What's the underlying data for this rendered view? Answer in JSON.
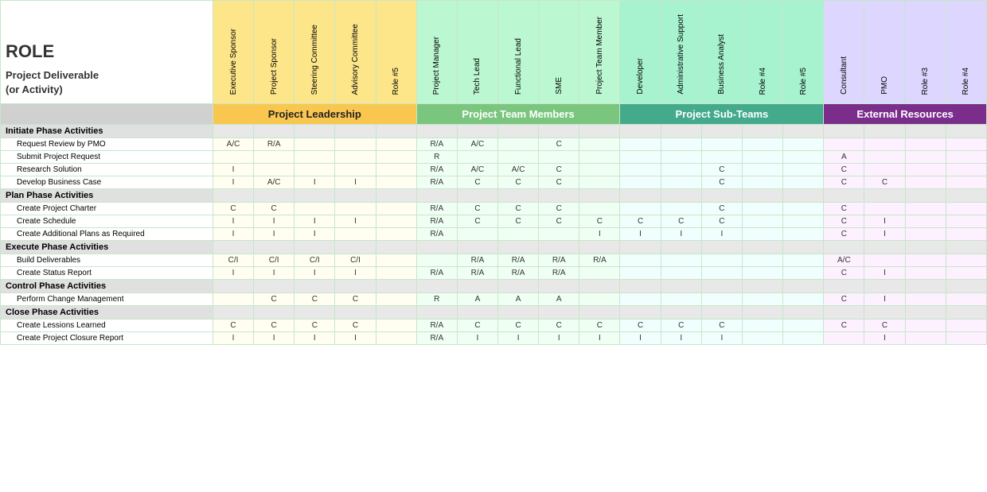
{
  "title": "ROLE",
  "leftHeader": {
    "line1": "Project Deliverable",
    "line2": "(or Activity)"
  },
  "groups": [
    {
      "id": "leadership",
      "label": "Project Leadership",
      "span": 5,
      "colorClass": "group-header-project-leadership",
      "headerClass": "header-cell-leadership"
    },
    {
      "id": "team",
      "label": "Project Team Members",
      "span": 5,
      "colorClass": "group-header-team-members",
      "headerClass": "header-cell-team"
    },
    {
      "id": "subteams",
      "label": "Project Sub-Teams",
      "span": 5,
      "colorClass": "group-header-sub-teams",
      "headerClass": "header-cell-subteam"
    },
    {
      "id": "external",
      "label": "External Resources",
      "span": 4,
      "colorClass": "group-header-external",
      "headerClass": "header-cell-external"
    }
  ],
  "roles": [
    {
      "label": "Executive Sponsor",
      "group": "leadership",
      "headerClass": "header-cell-leadership"
    },
    {
      "label": "Project Sponsor",
      "group": "leadership",
      "headerClass": "header-cell-leadership"
    },
    {
      "label": "Steering Committee",
      "group": "leadership",
      "headerClass": "header-cell-leadership"
    },
    {
      "label": "Advisory Committee",
      "group": "leadership",
      "headerClass": "header-cell-leadership"
    },
    {
      "label": "Role #5",
      "group": "leadership",
      "headerClass": "header-cell-leadership"
    },
    {
      "label": "Project Manager",
      "group": "team",
      "headerClass": "header-cell-team"
    },
    {
      "label": "Tech Lead",
      "group": "team",
      "headerClass": "header-cell-team"
    },
    {
      "label": "Functional Lead",
      "group": "team",
      "headerClass": "header-cell-team"
    },
    {
      "label": "SME",
      "group": "team",
      "headerClass": "header-cell-team"
    },
    {
      "label": "Project Team Member",
      "group": "team",
      "headerClass": "header-cell-team"
    },
    {
      "label": "Developer",
      "group": "subteams",
      "headerClass": "header-cell-subteam"
    },
    {
      "label": "Administrative Support",
      "group": "subteams",
      "headerClass": "header-cell-subteam"
    },
    {
      "label": "Business Analyst",
      "group": "subteams",
      "headerClass": "header-cell-subteam"
    },
    {
      "label": "Role #4",
      "group": "subteams",
      "headerClass": "header-cell-subteam"
    },
    {
      "label": "Role #5",
      "group": "subteams",
      "headerClass": "header-cell-subteam"
    },
    {
      "label": "Consultant",
      "group": "external",
      "headerClass": "header-cell-external"
    },
    {
      "label": "PMO",
      "group": "external",
      "headerClass": "header-cell-external"
    },
    {
      "label": "Role #3",
      "group": "external",
      "headerClass": "header-cell-external"
    },
    {
      "label": "Role #4",
      "group": "external",
      "headerClass": "header-cell-external"
    }
  ],
  "sections": [
    {
      "phase": "Initiate Phase Activities",
      "activities": [
        {
          "name": "Request Review by PMO",
          "cells": [
            "A/C",
            "R/A",
            "",
            "",
            "",
            "R/A",
            "A/C",
            "",
            "C",
            "",
            "",
            "",
            "",
            "",
            "",
            "",
            "",
            "",
            ""
          ]
        },
        {
          "name": "Submit Project Request",
          "cells": [
            "",
            "",
            "",
            "",
            "",
            "R",
            "",
            "",
            "",
            "",
            "",
            "",
            "",
            "",
            "",
            "A",
            "",
            "",
            ""
          ]
        },
        {
          "name": "Research Solution",
          "cells": [
            "I",
            "",
            "",
            "",
            "",
            "R/A",
            "A/C",
            "A/C",
            "C",
            "",
            "",
            "",
            "C",
            "",
            "",
            "C",
            "",
            "",
            ""
          ]
        },
        {
          "name": "Develop Business Case",
          "cells": [
            "I",
            "A/C",
            "I",
            "I",
            "",
            "R/A",
            "C",
            "C",
            "C",
            "",
            "",
            "",
            "C",
            "",
            "",
            "C",
            "C",
            "",
            ""
          ]
        }
      ]
    },
    {
      "phase": "Plan Phase Activities",
      "activities": [
        {
          "name": "Create Project Charter",
          "cells": [
            "C",
            "C",
            "",
            "",
            "",
            "R/A",
            "C",
            "C",
            "C",
            "",
            "",
            "",
            "C",
            "",
            "",
            "C",
            "",
            "",
            ""
          ]
        },
        {
          "name": "Create Schedule",
          "cells": [
            "I",
            "I",
            "I",
            "I",
            "",
            "R/A",
            "C",
            "C",
            "C",
            "C",
            "C",
            "C",
            "C",
            "",
            "",
            "C",
            "I",
            "",
            ""
          ]
        },
        {
          "name": "Create Additional Plans as Required",
          "cells": [
            "I",
            "I",
            "I",
            "",
            "",
            "R/A",
            "",
            "",
            "",
            "I",
            "I",
            "I",
            "I",
            "",
            "",
            "C",
            "I",
            "",
            ""
          ]
        }
      ]
    },
    {
      "phase": "Execute Phase Activities",
      "activities": [
        {
          "name": "Build Deliverables",
          "cells": [
            "C/I",
            "C/I",
            "C/I",
            "C/I",
            "",
            "",
            "R/A",
            "R/A",
            "R/A",
            "R/A",
            "",
            "",
            "",
            "",
            "",
            "A/C",
            "",
            "",
            ""
          ]
        },
        {
          "name": "Create Status Report",
          "cells": [
            "I",
            "I",
            "I",
            "I",
            "",
            "R/A",
            "R/A",
            "R/A",
            "R/A",
            "",
            "",
            "",
            "",
            "",
            "",
            "C",
            "I",
            "",
            ""
          ]
        }
      ]
    },
    {
      "phase": "Control Phase Activities",
      "activities": [
        {
          "name": "Perform Change Management",
          "cells": [
            "",
            "C",
            "C",
            "C",
            "",
            "R",
            "A",
            "A",
            "A",
            "",
            "",
            "",
            "",
            "",
            "",
            "C",
            "I",
            "",
            ""
          ]
        }
      ]
    },
    {
      "phase": "Close Phase Activities",
      "activities": [
        {
          "name": "Create Lessions Learned",
          "cells": [
            "C",
            "C",
            "C",
            "C",
            "",
            "R/A",
            "C",
            "C",
            "C",
            "C",
            "C",
            "C",
            "C",
            "",
            "",
            "C",
            "C",
            "",
            ""
          ]
        },
        {
          "name": "Create Project Closure Report",
          "cells": [
            "I",
            "I",
            "I",
            "I",
            "",
            "R/A",
            "I",
            "I",
            "I",
            "I",
            "I",
            "I",
            "I",
            "",
            "",
            "",
            "I",
            "",
            ""
          ]
        }
      ]
    }
  ]
}
